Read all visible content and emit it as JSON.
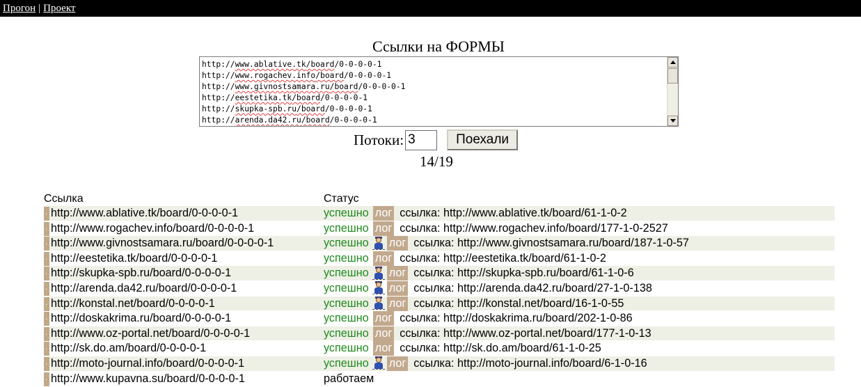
{
  "nav": {
    "run": "Прогон",
    "separator": "|",
    "project": "Проект"
  },
  "form": {
    "title": "Ссылки на ФОРМЫ",
    "urls": [
      "http://www.ablative.tk/board/0-0-0-0-1",
      "http://www.rogachev.info/board/0-0-0-0-1",
      "http://www.givnostsamara.ru/board/0-0-0-0-1",
      "http://eestetika.tk/board/0-0-0-0-1",
      "http://skupka-spb.ru/board/0-0-0-0-1",
      "http://arenda.da42.ru/board/0-0-0-0-1"
    ],
    "threads_label": "Потоки:",
    "threads_value": "3",
    "go_button": "Поехали",
    "progress": "14/19"
  },
  "table": {
    "col_link": "Ссылка",
    "col_status": "Статус",
    "rows": [
      {
        "url": "http://www.ablative.tk/board/0-0-0-0-1",
        "status": "успешно",
        "state": "ok",
        "captcha": false,
        "log": "лог",
        "result": "ссылка: http://www.ablative.tk/board/61-1-0-2"
      },
      {
        "url": "http://www.rogachev.info/board/0-0-0-0-1",
        "status": "успешно",
        "state": "ok",
        "captcha": false,
        "log": "лог",
        "result": "ссылка: http://www.rogachev.info/board/177-1-0-2527"
      },
      {
        "url": "http://www.givnostsamara.ru/board/0-0-0-0-1",
        "status": "успешно",
        "state": "ok",
        "captcha": true,
        "log": "лог",
        "result": "ссылка: http://www.givnostsamara.ru/board/187-1-0-57"
      },
      {
        "url": "http://eestetika.tk/board/0-0-0-0-1",
        "status": "успешно",
        "state": "ok",
        "captcha": false,
        "log": "лог",
        "result": "ссылка: http://eestetika.tk/board/61-1-0-2"
      },
      {
        "url": "http://skupka-spb.ru/board/0-0-0-0-1",
        "status": "успешно",
        "state": "ok",
        "captcha": true,
        "log": "лог",
        "result": "ссылка: http://skupka-spb.ru/board/61-1-0-6"
      },
      {
        "url": "http://arenda.da42.ru/board/0-0-0-0-1",
        "status": "успешно",
        "state": "ok",
        "captcha": true,
        "log": "лог",
        "result": "ссылка: http://arenda.da42.ru/board/27-1-0-138"
      },
      {
        "url": "http://konstal.net/board/0-0-0-0-1",
        "status": "успешно",
        "state": "ok",
        "captcha": true,
        "log": "лог",
        "result": "ссылка: http://konstal.net/board/16-1-0-55"
      },
      {
        "url": "http://doskakrima.ru/board/0-0-0-0-1",
        "status": "успешно",
        "state": "ok",
        "captcha": false,
        "log": "лог",
        "result": "ссылка: http://doskakrima.ru/board/202-1-0-86"
      },
      {
        "url": "http://www.oz-portal.net/board/0-0-0-0-1",
        "status": "успешно",
        "state": "ok",
        "captcha": false,
        "log": "лог",
        "result": "ссылка: http://www.oz-portal.net/board/177-1-0-13"
      },
      {
        "url": "http://sk.do.am/board/0-0-0-0-1",
        "status": "успешно",
        "state": "ok",
        "captcha": false,
        "log": "лог",
        "result": "ссылка: http://sk.do.am/board/61-1-0-25"
      },
      {
        "url": "http://moto-journal.info/board/0-0-0-0-1",
        "status": "успешно",
        "state": "ok",
        "captcha": true,
        "log": "лог",
        "result": "ссылка: http://moto-journal.info/board/6-1-0-16"
      },
      {
        "url": "http://www.kupavna.su/board/0-0-0-0-1",
        "status": "работаем",
        "state": "working",
        "captcha": false,
        "log": "",
        "result": ""
      }
    ]
  },
  "colors": {
    "ok": "#1f8a1f",
    "log_bg": "#c2a98e",
    "row_shade": "#eef0e6",
    "topbar": "#000000"
  },
  "icons": {
    "captcha": "captcha-person-icon"
  }
}
